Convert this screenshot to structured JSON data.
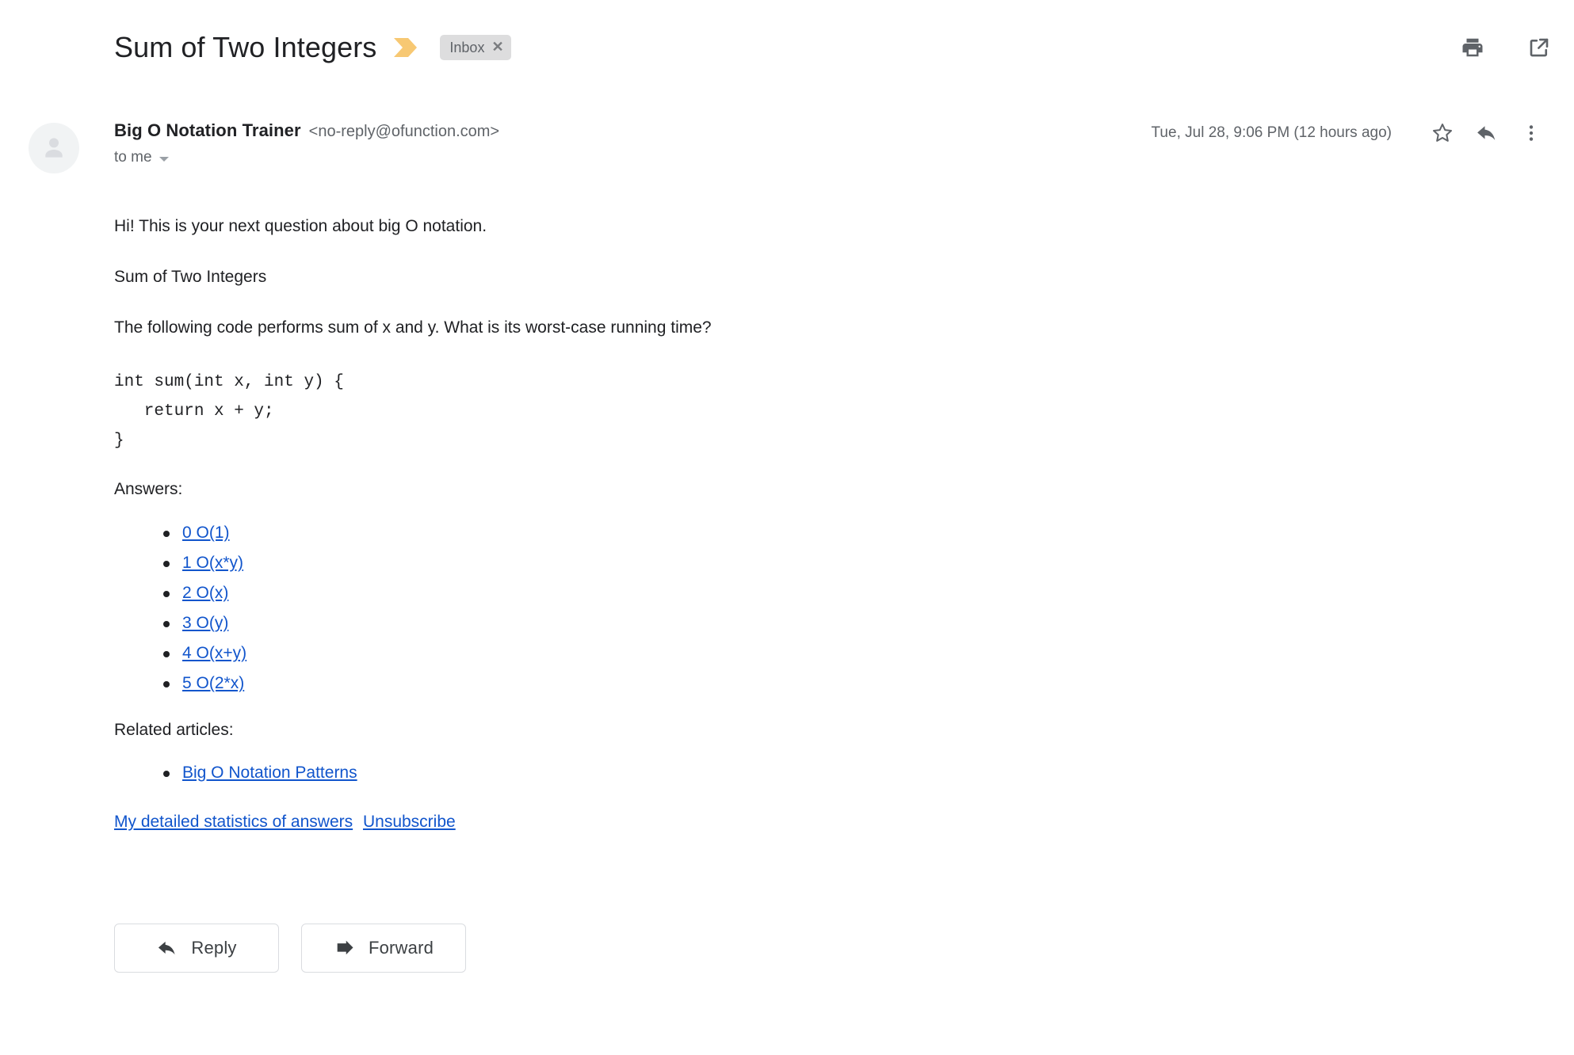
{
  "header": {
    "subject": "Sum of Two Integers",
    "marker_icon": "chevron-marker-icon",
    "marker_color": "#f7c873",
    "label": {
      "name": "Inbox",
      "remove_glyph": "✕"
    },
    "actions": [
      {
        "name": "print-icon",
        "label": "Print"
      },
      {
        "name": "open-in-new-icon",
        "label": "Open in new window"
      }
    ]
  },
  "message": {
    "avatar_icon": "default-avatar-icon",
    "sender_name": "Big O Notation Trainer",
    "sender_email": "<no-reply@ofunction.com>",
    "recipient": "to me",
    "timestamp": "Tue, Jul 28, 9:06 PM (12 hours ago)",
    "actions": [
      {
        "name": "star-icon",
        "label": "Star"
      },
      {
        "name": "reply-icon",
        "label": "Reply"
      },
      {
        "name": "more-options-icon",
        "label": "More"
      }
    ]
  },
  "body": {
    "greeting": "Hi! This is your next question about big O notation.",
    "question_title": "Sum of Two Integers",
    "question_text": "The following code performs sum of x and y. What is its worst-case running time?",
    "code": "int sum(int x, int y) {\n   return x + y;\n}",
    "answers_label": "Answers:",
    "answers": [
      "0 O(1)",
      "1 O(x*y)",
      "2 O(x)",
      "3 O(y)",
      "4 O(x+y)",
      "5 O(2*x)"
    ],
    "related_label": "Related articles:",
    "related_articles": [
      "Big O Notation Patterns"
    ],
    "footer_links": [
      "My detailed statistics of answers",
      "Unsubscribe"
    ],
    "link_color": "#1155cc"
  },
  "buttons": {
    "reply": "Reply",
    "forward": "Forward"
  }
}
